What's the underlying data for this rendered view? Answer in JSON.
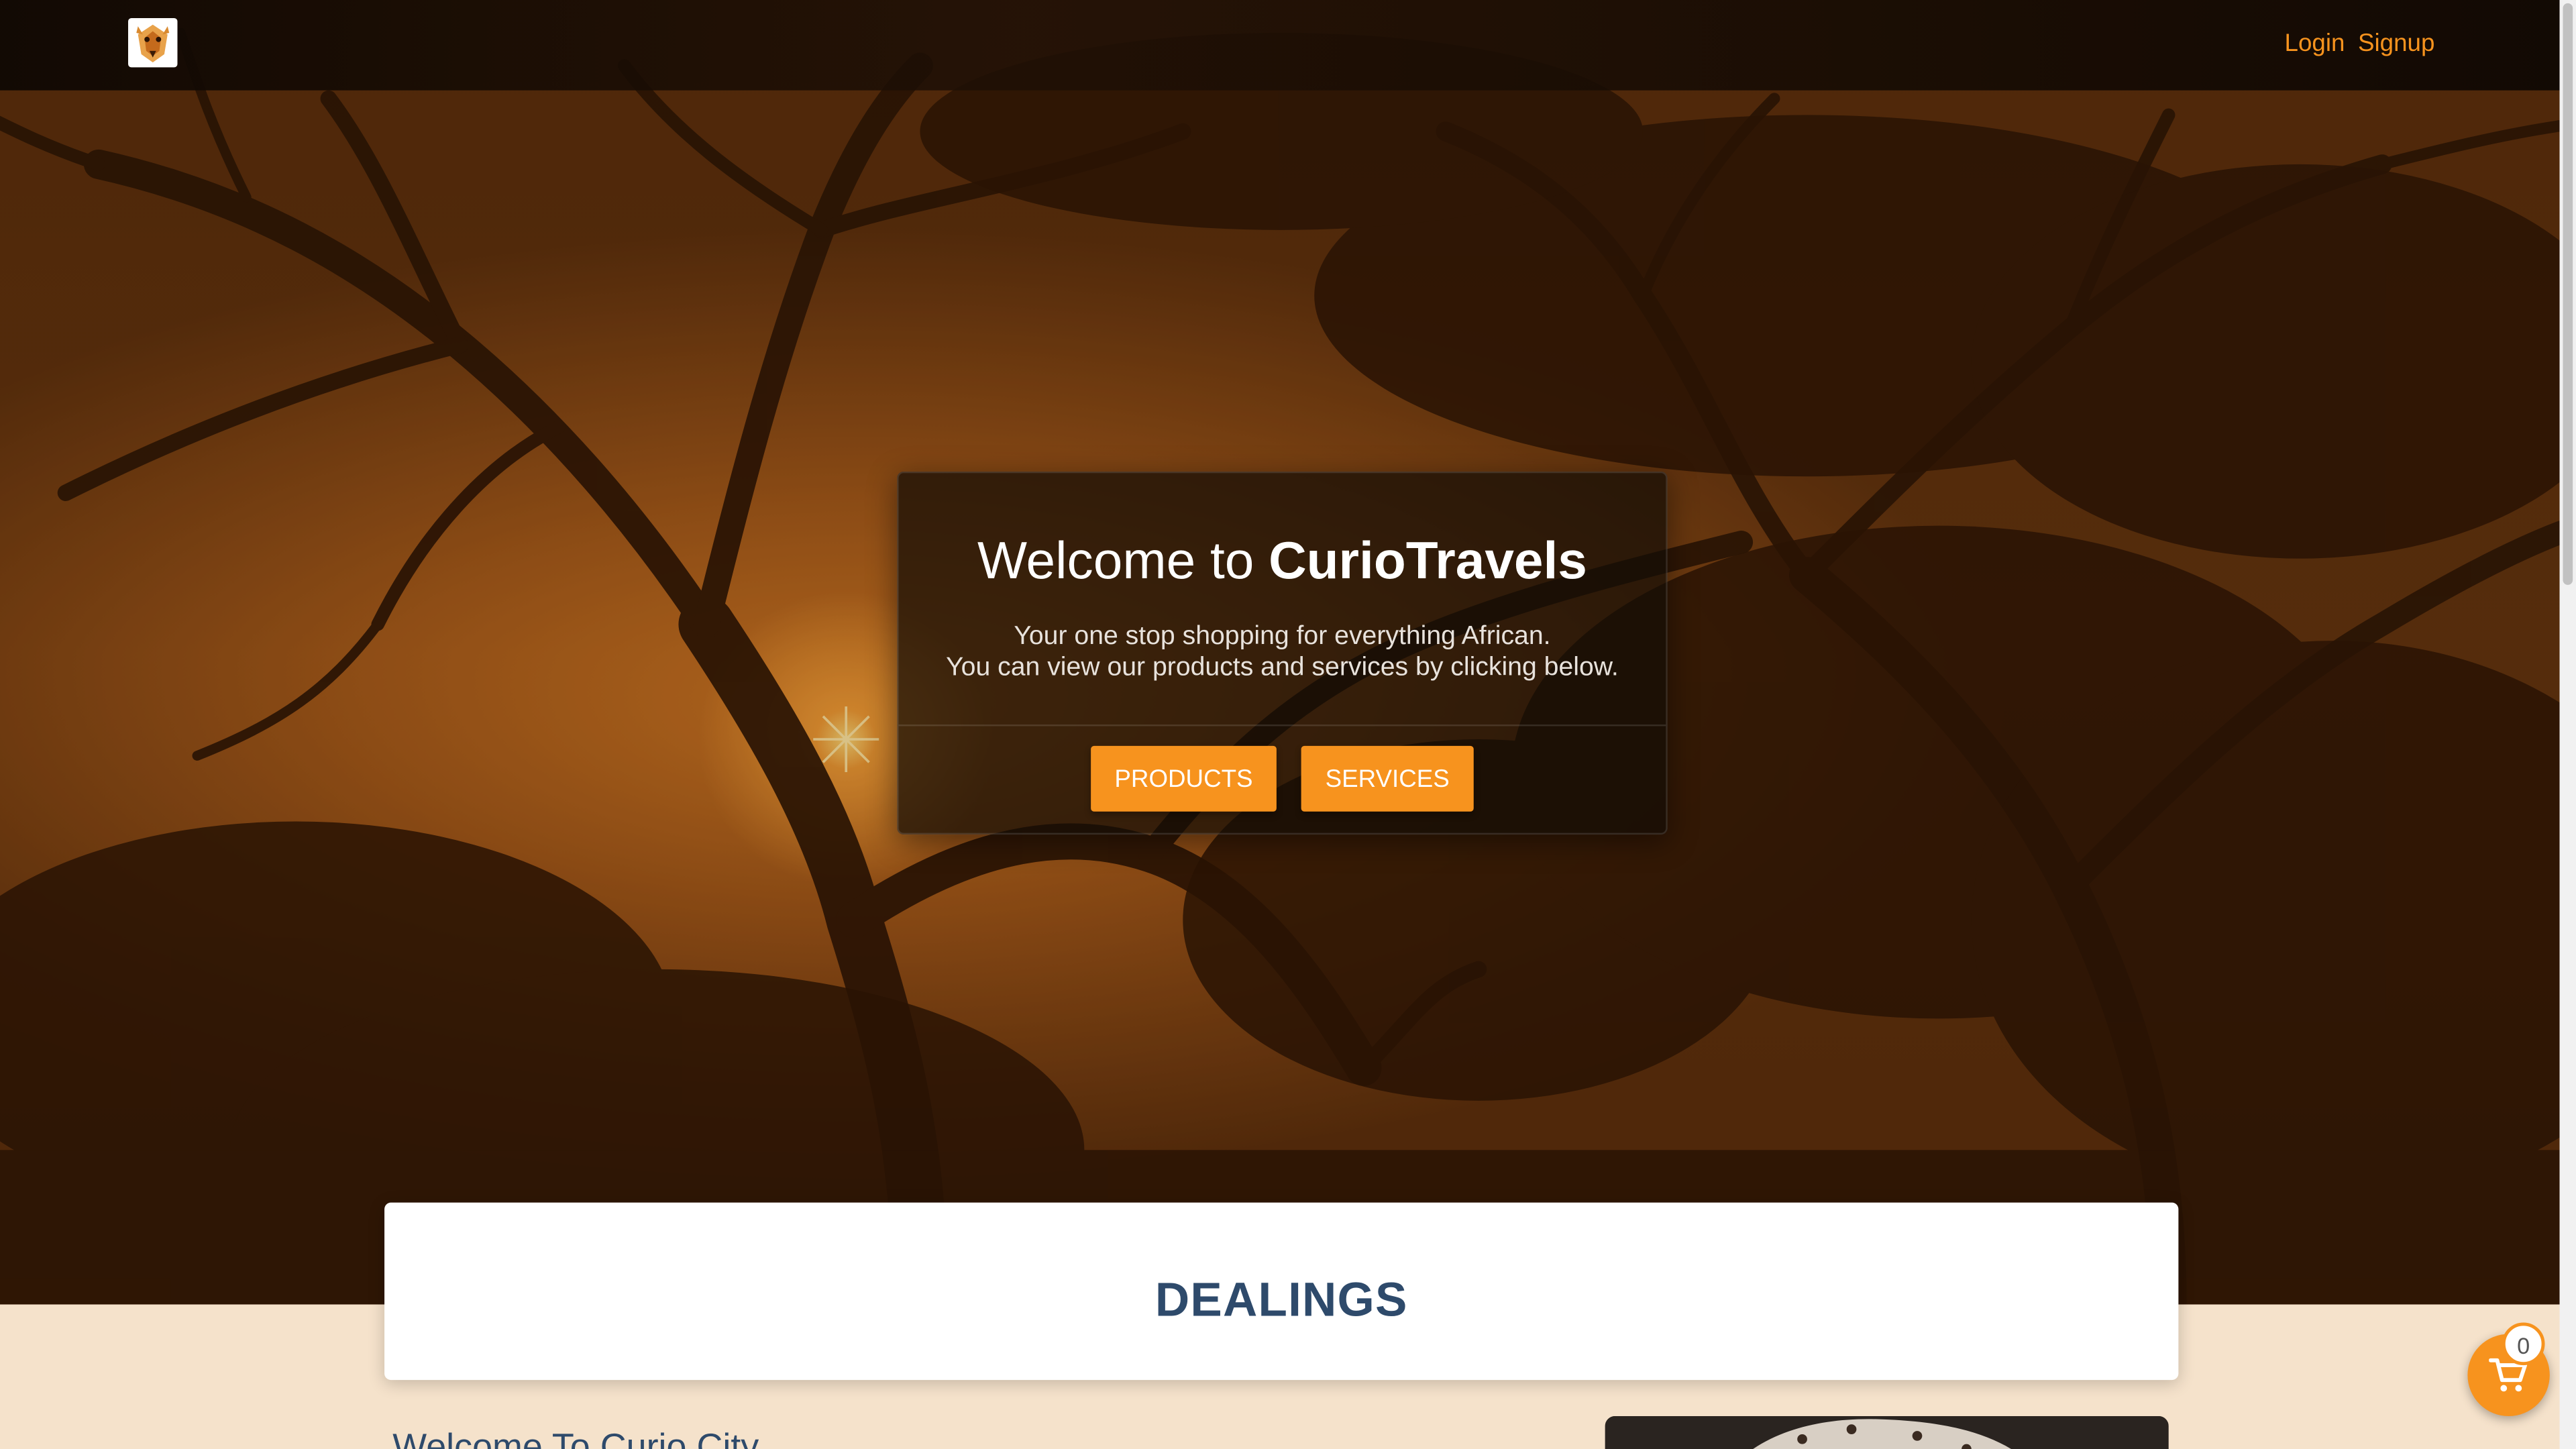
{
  "nav": {
    "login": "Login",
    "signup": "Signup"
  },
  "hero": {
    "title_prefix": "Welcome to ",
    "title_brand": "CurioTravels",
    "line1": "Your one stop shopping for everything African.",
    "line2": "You can view our products and services by clicking below.",
    "products_button": "PRODUCTS",
    "services_button": "SERVICES"
  },
  "dealings": {
    "heading": "DEALINGS"
  },
  "intro": {
    "heading": "Welcome To Curio City"
  },
  "cart": {
    "count": "0"
  },
  "colors": {
    "accent": "#f7931e",
    "heading": "#2e4a6b",
    "page_bg": "#f5e2cb"
  },
  "icons": [
    "giraffe-logo-icon",
    "shopping-cart-icon"
  ]
}
